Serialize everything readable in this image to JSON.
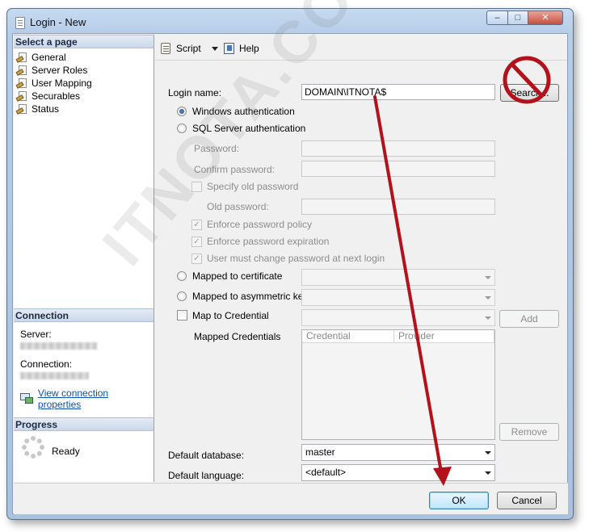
{
  "window": {
    "title": "Login - New",
    "minimize_glyph": "–",
    "maximize_glyph": "□",
    "close_glyph": "✕"
  },
  "left": {
    "select_page_header": "Select a page",
    "pages": [
      {
        "label": "General",
        "icon": "page-wrench-icon"
      },
      {
        "label": "Server Roles",
        "icon": "page-wrench-icon"
      },
      {
        "label": "User Mapping",
        "icon": "page-wrench-icon"
      },
      {
        "label": "Securables",
        "icon": "page-wrench-icon"
      },
      {
        "label": "Status",
        "icon": "page-wrench-icon"
      }
    ],
    "connection_header": "Connection",
    "server_label": "Server:",
    "connection_label": "Connection:",
    "view_connection_properties": "View connection properties",
    "progress_header": "Progress",
    "progress_status": "Ready"
  },
  "toolbar": {
    "script_label": "Script",
    "help_label": "Help"
  },
  "form": {
    "login_name_label": "Login name:",
    "login_name_value": "DOMAIN\\ITNOTA$",
    "search_button": "Search...",
    "windows_auth": "Windows authentication",
    "sql_auth": "SQL Server authentication",
    "password_label": "Password:",
    "confirm_password_label": "Confirm password:",
    "specify_old_password": "Specify old password",
    "old_password_label": "Old password:",
    "enforce_policy": "Enforce password policy",
    "enforce_expiration": "Enforce password expiration",
    "must_change": "User must change password at next login",
    "mapped_certificate": "Mapped to certificate",
    "mapped_asym_key": "Mapped to asymmetric key",
    "map_credential": "Map to Credential",
    "add_button": "Add",
    "mapped_credentials_label": "Mapped Credentials",
    "grid_columns": [
      "Credential",
      "Provider"
    ],
    "remove_button": "Remove",
    "default_database_label": "Default database:",
    "default_database_value": "master",
    "default_language_label": "Default language:",
    "default_language_value": "<default>"
  },
  "footer": {
    "ok_button": "OK",
    "cancel_button": "Cancel"
  },
  "overlay": {
    "watermark": "ITNOTA.COM"
  },
  "colors": {
    "annotation_red": "#b3121c",
    "link_blue": "#0d52b0"
  }
}
